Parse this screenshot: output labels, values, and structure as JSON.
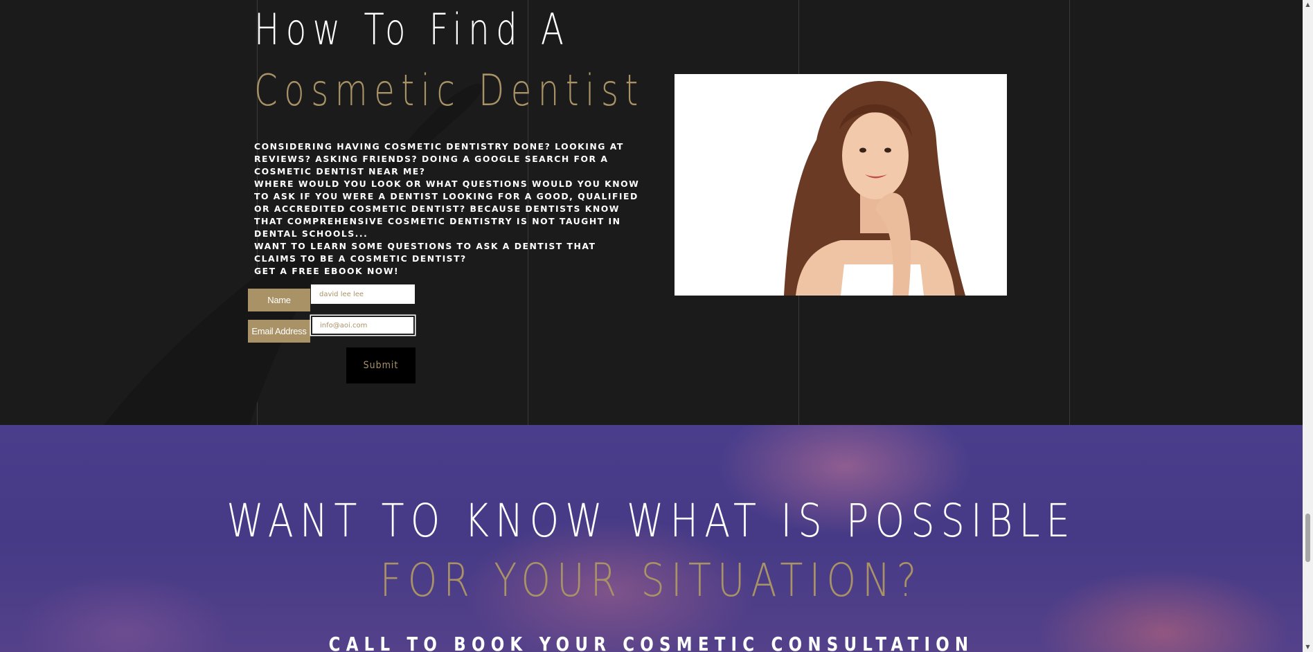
{
  "ebook_section": {
    "heading_line1": "How To Find A",
    "heading_line2": "Cosmetic Dentist",
    "paragraphs": [
      "Considering having cosmetic dentistry done? Looking at reviews? Asking friends? Doing a Google search for a cosmetic dentist near me?",
      "Where would you look or what questions would you know to ask if you were a dentist looking for a good, qualified or accredited cosmetic dentist? Because dentists know that comprehensive cosmetic dentistry is not taught in dental schools...",
      "Want to learn some questions to ask a dentist that claims to be a cosmetic dentist?",
      "Get a FREE EBOOK NOW!"
    ],
    "form": {
      "name_label": "Name",
      "name_value": "david lee lee",
      "email_label": "Email Address",
      "email_placeholder": "info@aoi.com",
      "submit_label": "Submit"
    }
  },
  "cta_section": {
    "line1": "WANT TO KNOW WHAT IS POSSIBLE",
    "line2": "FOR YOUR SITUATION?",
    "line3": "CALL TO BOOK YOUR COSMETIC CONSULTATION"
  },
  "colors": {
    "background": "#1b1b1b",
    "gold_accent": "#a89266",
    "purple_background": "#4a3e8c"
  },
  "scrollbar": {
    "scroll_position_fraction": 0.83
  }
}
